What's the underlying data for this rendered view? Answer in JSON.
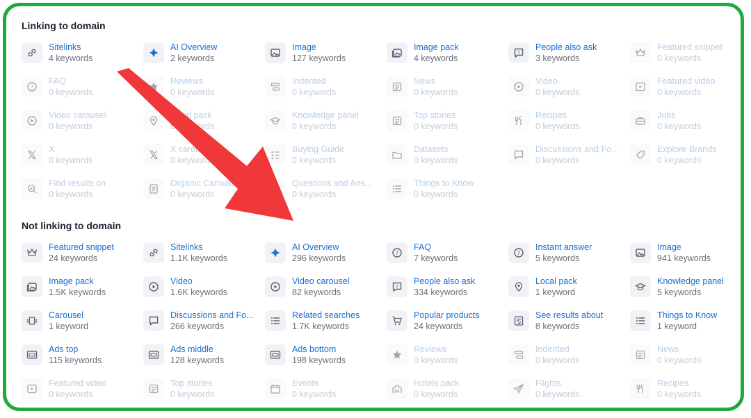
{
  "sections": {
    "linking": {
      "title": "Linking to domain",
      "items": [
        {
          "name": "Sitelinks",
          "count": "4 keywords",
          "icon": "link-icon",
          "active": true
        },
        {
          "name": "AI Overview",
          "count": "2 keywords",
          "icon": "ai-overview-icon",
          "active": true
        },
        {
          "name": "Image",
          "count": "127 keywords",
          "icon": "image-icon",
          "active": true
        },
        {
          "name": "Image pack",
          "count": "4 keywords",
          "icon": "image-pack-icon",
          "active": true
        },
        {
          "name": "People also ask",
          "count": "3 keywords",
          "icon": "people-also-ask-icon",
          "active": true
        },
        {
          "name": "Featured snippet",
          "count": "0 keywords",
          "icon": "crown-icon",
          "active": false
        },
        {
          "name": "FAQ",
          "count": "0 keywords",
          "icon": "question-icon",
          "active": false
        },
        {
          "name": "Reviews",
          "count": "0 keywords",
          "icon": "star-icon",
          "active": false
        },
        {
          "name": "Indented",
          "count": "0 keywords",
          "icon": "indented-icon",
          "active": false
        },
        {
          "name": "News",
          "count": "0 keywords",
          "icon": "news-icon",
          "active": false
        },
        {
          "name": "Video",
          "count": "0 keywords",
          "icon": "play-icon",
          "active": false
        },
        {
          "name": "Featured video",
          "count": "0 keywords",
          "icon": "featured-video-icon",
          "active": false
        },
        {
          "name": "Video carousel",
          "count": "0 keywords",
          "icon": "play-icon",
          "active": false
        },
        {
          "name": "Local pack",
          "count": "0 keywords",
          "icon": "pin-icon",
          "active": false
        },
        {
          "name": "Knowledge panel",
          "count": "0 keywords",
          "icon": "graduation-cap-icon",
          "active": false
        },
        {
          "name": "Top stories",
          "count": "0 keywords",
          "icon": "news-icon",
          "active": false
        },
        {
          "name": "Recipes",
          "count": "0 keywords",
          "icon": "cutlery-icon",
          "active": false
        },
        {
          "name": "Jobs",
          "count": "0 keywords",
          "icon": "briefcase-icon",
          "active": false
        },
        {
          "name": "X",
          "count": "0 keywords",
          "icon": "x-logo-icon",
          "active": false
        },
        {
          "name": "X carousel",
          "count": "0 keywords",
          "icon": "x-logo-icon",
          "active": false
        },
        {
          "name": "Buying Guide",
          "count": "0 keywords",
          "icon": "checklist-icon",
          "active": false
        },
        {
          "name": "Datasets",
          "count": "0 keywords",
          "icon": "folder-icon",
          "active": false
        },
        {
          "name": "Discussions and Fo...",
          "count": "0 keywords",
          "icon": "chat-icon",
          "active": false
        },
        {
          "name": "Explore Brands",
          "count": "0 keywords",
          "icon": "tag-icon",
          "active": false
        },
        {
          "name": "Find results on",
          "count": "0 keywords",
          "icon": "search-check-icon",
          "active": false
        },
        {
          "name": "Organic Carousel",
          "count": "0 keywords",
          "icon": "carousel-doc-icon",
          "active": false
        },
        {
          "name": "Questions and Ans...",
          "count": "0 keywords",
          "icon": "qa-icon",
          "active": false
        },
        {
          "name": "Things to Know",
          "count": "0 keywords",
          "icon": "list-icon",
          "active": false
        }
      ]
    },
    "not_linking": {
      "title": "Not linking to domain",
      "items": [
        {
          "name": "Featured snippet",
          "count": "24 keywords",
          "icon": "crown-icon",
          "active": true
        },
        {
          "name": "Sitelinks",
          "count": "1.1K keywords",
          "icon": "link-icon",
          "active": true
        },
        {
          "name": "AI Overview",
          "count": "296 keywords",
          "icon": "ai-overview-icon",
          "active": true
        },
        {
          "name": "FAQ",
          "count": "7 keywords",
          "icon": "question-icon",
          "active": true
        },
        {
          "name": "Instant answer",
          "count": "5 keywords",
          "icon": "question-icon",
          "active": true
        },
        {
          "name": "Image",
          "count": "941 keywords",
          "icon": "image-icon",
          "active": true
        },
        {
          "name": "Image pack",
          "count": "1.5K keywords",
          "icon": "image-pack-icon",
          "active": true
        },
        {
          "name": "Video",
          "count": "1.6K keywords",
          "icon": "play-icon",
          "active": true
        },
        {
          "name": "Video carousel",
          "count": "82 keywords",
          "icon": "play-icon",
          "active": true
        },
        {
          "name": "People also ask",
          "count": "334 keywords",
          "icon": "people-also-ask-icon",
          "active": true
        },
        {
          "name": "Local pack",
          "count": "1 keyword",
          "icon": "pin-icon",
          "active": true
        },
        {
          "name": "Knowledge panel",
          "count": "5 keywords",
          "icon": "graduation-cap-icon",
          "active": true
        },
        {
          "name": "Carousel",
          "count": "1 keyword",
          "icon": "carousel-icon",
          "active": true
        },
        {
          "name": "Discussions and Fo...",
          "count": "266 keywords",
          "icon": "chat-icon",
          "active": true
        },
        {
          "name": "Related searches",
          "count": "1.7K keywords",
          "icon": "list-icon",
          "active": true
        },
        {
          "name": "Popular products",
          "count": "24 keywords",
          "icon": "cart-icon",
          "active": true
        },
        {
          "name": "See results about",
          "count": "8 keywords",
          "icon": "doc-check-icon",
          "active": true
        },
        {
          "name": "Things to Know",
          "count": "1 keyword",
          "icon": "list-icon",
          "active": true
        },
        {
          "name": "Ads top",
          "count": "115 keywords",
          "icon": "ad-icon",
          "active": true
        },
        {
          "name": "Ads middle",
          "count": "128 keywords",
          "icon": "ad-icon",
          "active": true
        },
        {
          "name": "Ads bottom",
          "count": "198 keywords",
          "icon": "ad-icon",
          "active": true
        },
        {
          "name": "Reviews",
          "count": "0 keywords",
          "icon": "star-icon",
          "active": false
        },
        {
          "name": "Indented",
          "count": "0 keywords",
          "icon": "indented-icon",
          "active": false
        },
        {
          "name": "News",
          "count": "0 keywords",
          "icon": "news-icon",
          "active": false
        },
        {
          "name": "Featured video",
          "count": "0 keywords",
          "icon": "featured-video-icon",
          "active": false
        },
        {
          "name": "Top stories",
          "count": "0 keywords",
          "icon": "news-icon",
          "active": false
        },
        {
          "name": "Events",
          "count": "0 keywords",
          "icon": "calendar-icon",
          "active": false
        },
        {
          "name": "Hotels pack",
          "count": "0 keywords",
          "icon": "hotel-icon",
          "active": false
        },
        {
          "name": "Flights",
          "count": "0 keywords",
          "icon": "plane-icon",
          "active": false
        },
        {
          "name": "Recipes",
          "count": "0 keywords",
          "icon": "cutlery-icon",
          "active": false
        }
      ]
    }
  },
  "colors": {
    "frame_border": "#1eab3a",
    "link_text": "#1b6fd0",
    "arrow": "#f0383b"
  }
}
